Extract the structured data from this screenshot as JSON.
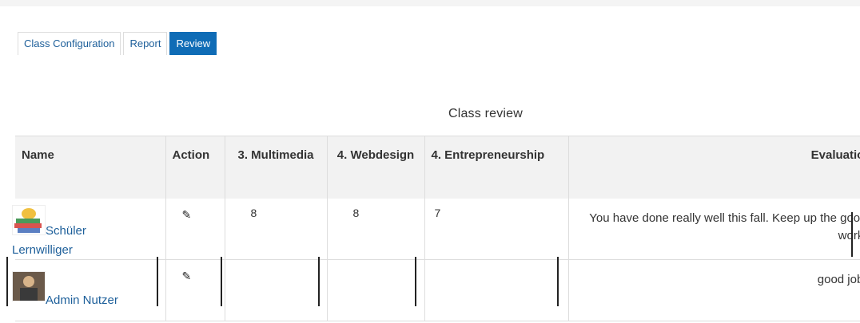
{
  "tabs": [
    {
      "label": "Class Configuration"
    },
    {
      "label": "Report"
    },
    {
      "label": "Review"
    }
  ],
  "caption": "Class review",
  "columns": {
    "name": "Name",
    "action": "Action",
    "multimedia": "3. Multimedia",
    "webdesign": "4. Webdesign",
    "entrepreneurship": "4. Entrepreneurship",
    "evaluation": "Evaluation"
  },
  "rows": [
    {
      "name_part1": "Schüler",
      "name_part2": "Lernwilliger",
      "action_icon": "edit-icon",
      "multimedia": "8",
      "webdesign": "8",
      "entrepreneurship": "7",
      "evaluation": "You have done really well this fall. Keep up the good work!"
    },
    {
      "name_part1": "Admin Nutzer",
      "name_part2": "",
      "action_icon": "edit-icon",
      "multimedia": "",
      "webdesign": "",
      "entrepreneurship": "",
      "evaluation": "good job!"
    }
  ],
  "colors": {
    "tab_active_bg": "#0f6cb6",
    "link": "#1d5f9a",
    "header_bg": "#f2f2f2"
  }
}
